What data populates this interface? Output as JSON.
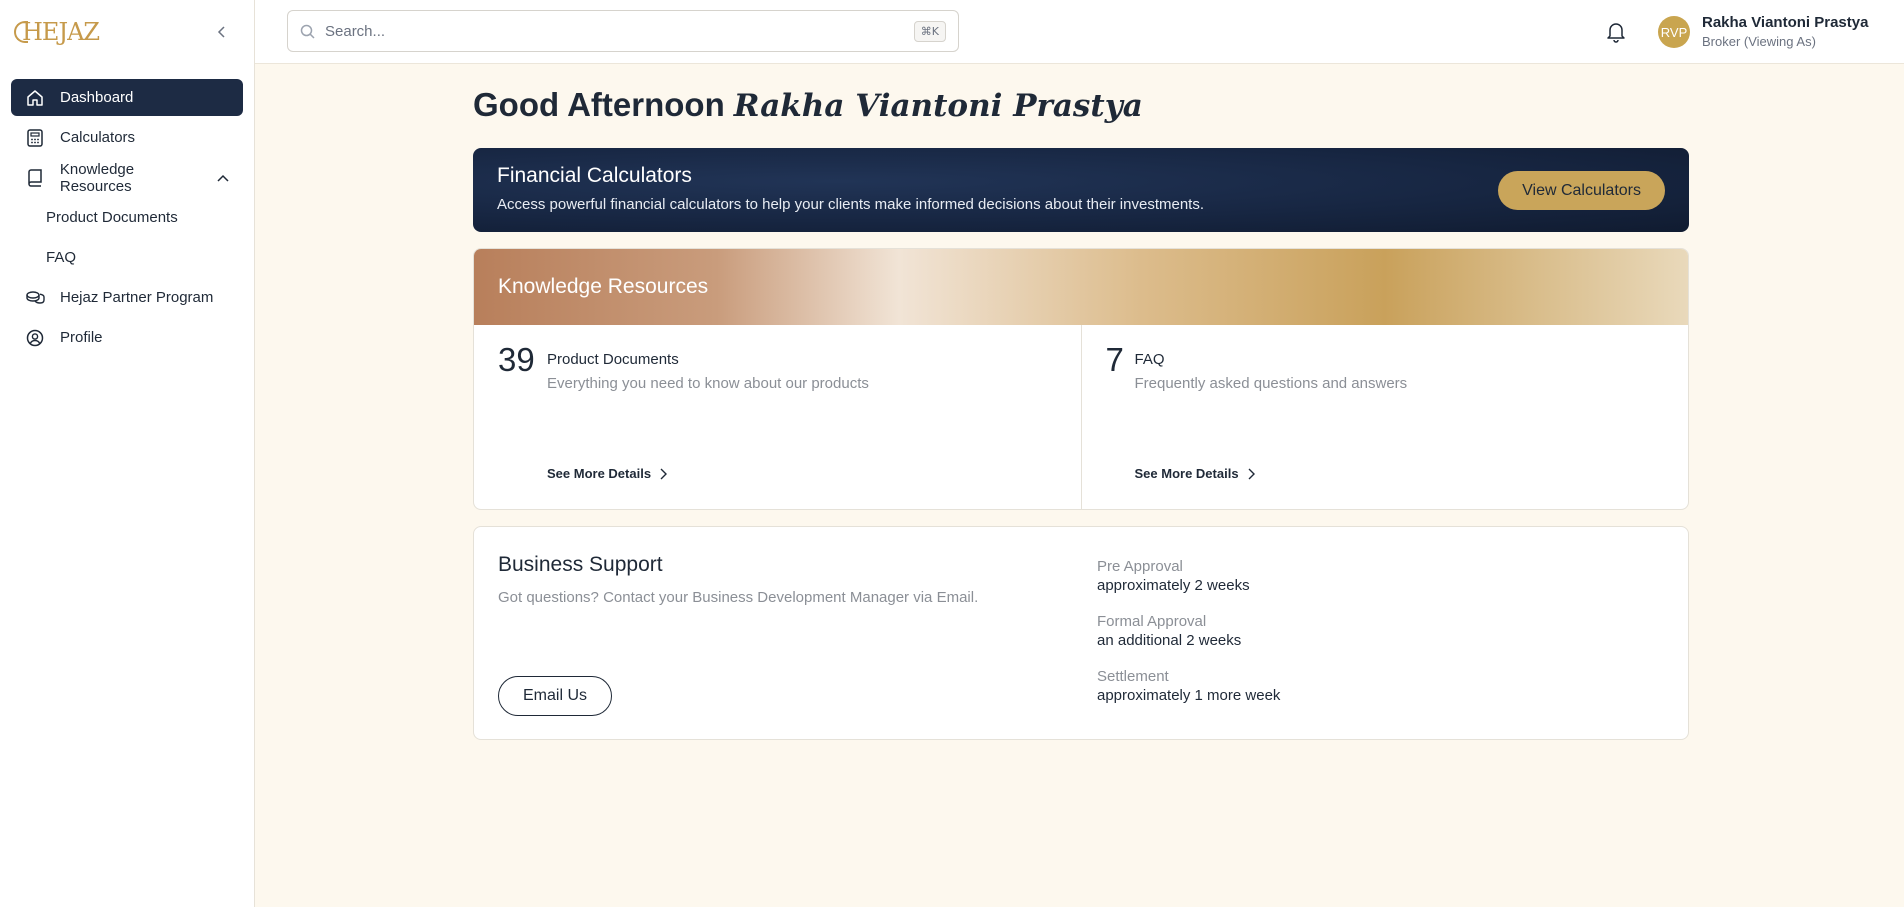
{
  "brand": {
    "logo_text": "HEJAZ"
  },
  "sidebar": {
    "items": [
      {
        "label": "Dashboard",
        "icon": "home-icon",
        "active": true
      },
      {
        "label": "Calculators",
        "icon": "calculator-icon"
      },
      {
        "label": "Knowledge Resources",
        "icon": "book-icon",
        "expanded": true
      },
      {
        "label": "Product Documents",
        "sub": true
      },
      {
        "label": "FAQ",
        "sub": true
      },
      {
        "label": "Hejaz Partner Program",
        "icon": "coins-icon"
      },
      {
        "label": "Profile",
        "icon": "user-circle-icon"
      }
    ]
  },
  "search": {
    "placeholder": "Search...",
    "shortcut": "⌘K"
  },
  "user": {
    "initials": "RVP",
    "name": "Rakha Viantoni Prastya",
    "role": "Broker (Viewing As)"
  },
  "greeting": {
    "prefix": "Good Afternoon",
    "name": "Rakha Viantoni Prastya"
  },
  "financial_calculators": {
    "title": "Financial Calculators",
    "description": "Access powerful financial calculators to help your clients make informed decisions about their investments.",
    "button_label": "View Calculators"
  },
  "knowledge_resources": {
    "title": "Knowledge Resources",
    "items": [
      {
        "count": "39",
        "label": "Product Documents",
        "description": "Everything you need to know about our products",
        "link": "See More Details"
      },
      {
        "count": "7",
        "label": "FAQ",
        "description": "Frequently asked questions and answers",
        "link": "See More Details"
      }
    ]
  },
  "business_support": {
    "title": "Business Support",
    "description": "Got questions? Contact your Business Development Manager via Email.",
    "button_label": "Email Us",
    "timeline": [
      {
        "label": "Pre Approval",
        "value": "approximately 2 weeks"
      },
      {
        "label": "Formal Approval",
        "value": "an additional 2 weeks"
      },
      {
        "label": "Settlement",
        "value": "approximately 1 more week"
      }
    ]
  },
  "colors": {
    "navy": "#1d2b44",
    "gold": "#c9a55a",
    "background": "#fdf8ee"
  }
}
